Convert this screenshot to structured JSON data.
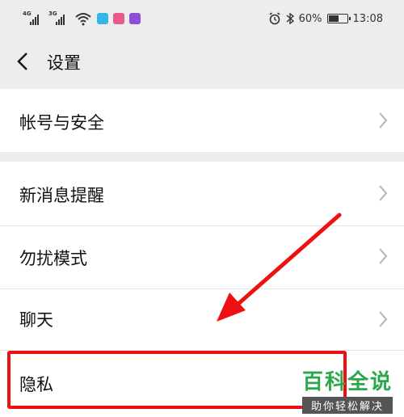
{
  "status_bar": {
    "network1": "4G",
    "network2": "3G",
    "battery_percent_text": "60%",
    "battery_level": 0.6,
    "time": "13:08",
    "app_icon_colors": [
      "#33b6e6",
      "#e85a8a",
      "#8d4fd6"
    ]
  },
  "nav": {
    "title": "设置",
    "back_icon": "chevron-left-icon"
  },
  "sections": [
    {
      "items": [
        {
          "label": "帐号与安全"
        }
      ]
    },
    {
      "items": [
        {
          "label": "新消息提醒"
        },
        {
          "label": "勿扰模式"
        },
        {
          "label": "聊天"
        },
        {
          "label": "隐私"
        }
      ]
    }
  ],
  "annotation": {
    "arrow_color": "#e11",
    "highlight_color": "#e11"
  },
  "watermark": {
    "main": "百科全说",
    "sub": "助你轻松解决"
  }
}
